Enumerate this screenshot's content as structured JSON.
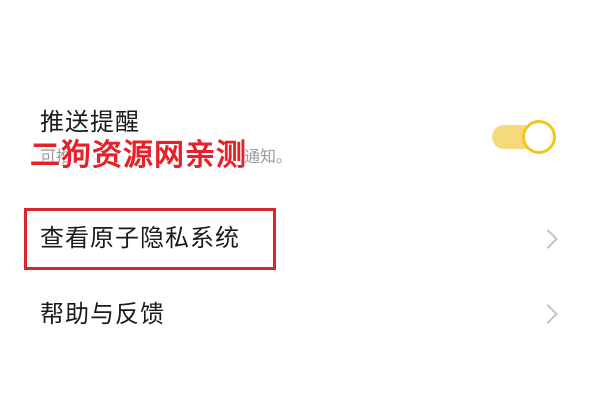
{
  "settings": {
    "push": {
      "title": "推送提醒",
      "description_start": "可推",
      "description_end": "通知。",
      "toggle_on": true,
      "toggle_color": "#f2c61f"
    },
    "privacy": {
      "label": "查看原子隐私系统",
      "chevron_icon": "chevron-right-icon",
      "highlight_color": "#d8262d"
    },
    "help": {
      "label": "帮助与反馈",
      "chevron_icon": "chevron-right-icon"
    }
  },
  "watermark": {
    "text": "二狗资源网亲测",
    "color": "#e8202a"
  }
}
